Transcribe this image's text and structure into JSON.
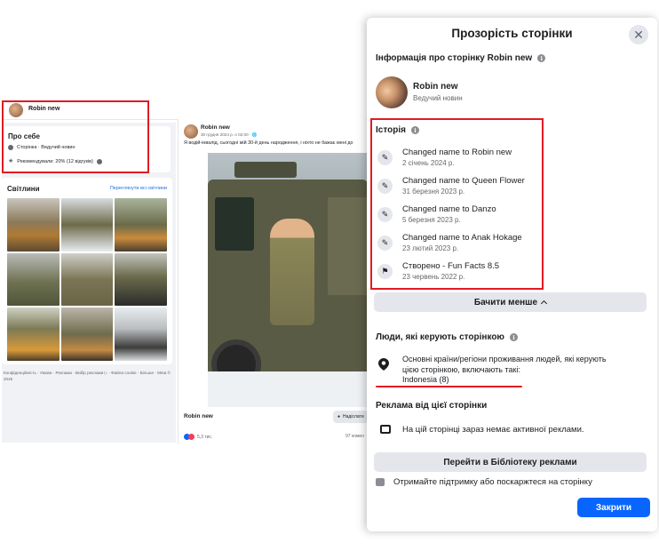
{
  "background_page": {
    "page_name": "Robin new",
    "about": {
      "title": "Про себе",
      "category": "Сторінка · Ведучий новин",
      "recommend": "Рекомендували: 20% (12 відгуків)"
    },
    "photos": {
      "title": "Світлини",
      "see_all": "Переглянути всі світлини"
    },
    "footer_links": "Конфіденційність · Умови · Реклама · Вибір реклами ▷ · Файли cookie · Більше · Meta © 2025",
    "post": {
      "author": "Robin new",
      "date": "30 грудня 2024 р. о 02:00 · 🌐",
      "text": "Я водій-інвалід, сьогодні мій 30-й день народження, і ніхто не бажає мені до",
      "footer_name": "Robin new",
      "send_label": "Надіслати",
      "reactions": "5,3 тис.",
      "comments": "97 комен"
    }
  },
  "dialog": {
    "title": "Прозорість сторінки",
    "info_section": {
      "title": "Інформація про сторінку Robin new",
      "page_name": "Robin new",
      "page_category": "Ведучий новин"
    },
    "history": {
      "title": "Історія",
      "items": [
        {
          "text": "Changed name to Robin new",
          "date": "2 січень 2024 р.",
          "icon": "edit-icon"
        },
        {
          "text": "Changed name to Queen Flower",
          "date": "31 березня 2023 р.",
          "icon": "edit-icon"
        },
        {
          "text": "Changed name to Danzo",
          "date": "5 березня 2023 р.",
          "icon": "edit-icon"
        },
        {
          "text": "Changed name to Anak Hokage",
          "date": "23 лютий 2023 р.",
          "icon": "edit-icon"
        },
        {
          "text": "Створено - Fun Facts 8.5",
          "date": "23 червень 2022 р.",
          "icon": "flag-icon"
        }
      ],
      "see_less": "Бачити менше"
    },
    "managers": {
      "title": "Люди, які керують сторінкою",
      "description": "Основні країни/регіони проживання людей, які керують цією сторінкою, включають такі:",
      "country": "Indonesia (8)"
    },
    "ads": {
      "title": "Реклама від цієї сторінки",
      "text": "На цій сторінці зараз немає активної реклами.",
      "library_button": "Перейти в Бібліотеку реклами"
    },
    "support": "Отримайте підтримку або поскаржтеся на сторінку",
    "close_button": "Закрити"
  },
  "colors": {
    "primary": "#0866ff",
    "highlight": "#e01b24",
    "link": "#216fdb"
  }
}
